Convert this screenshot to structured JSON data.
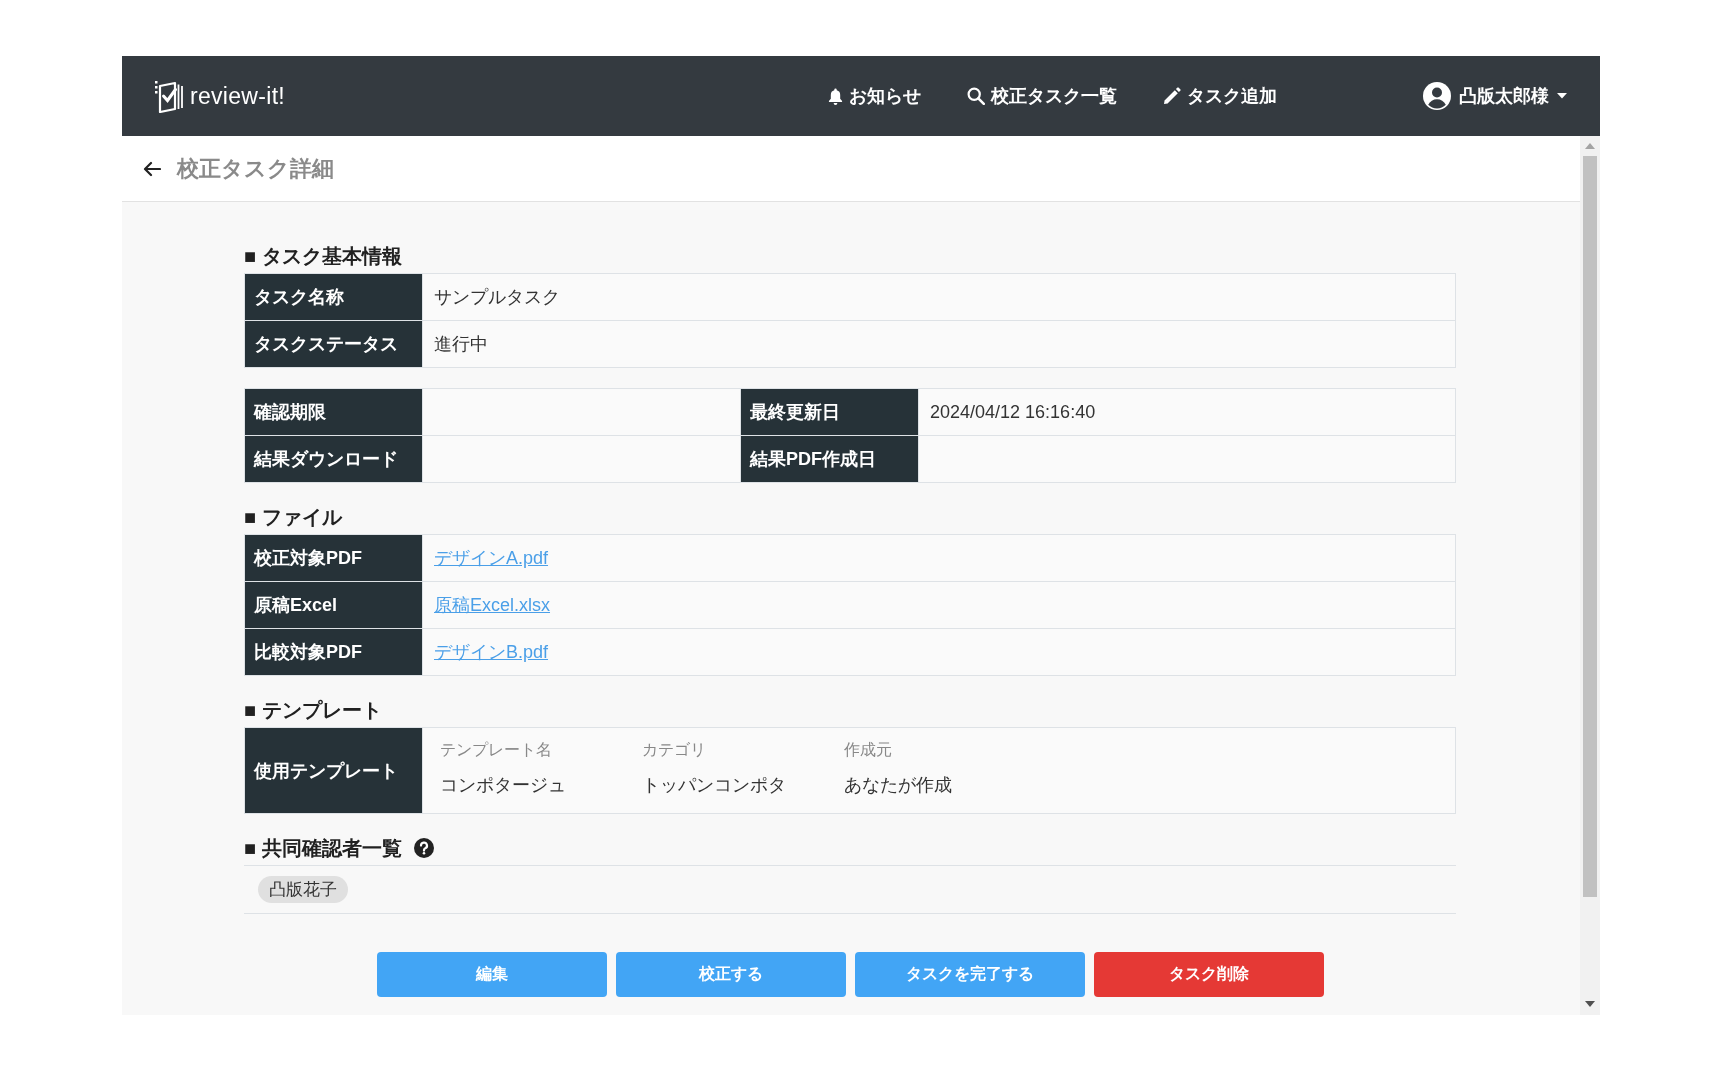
{
  "header": {
    "logo": "review-it!",
    "nav": [
      {
        "kind": "notifications",
        "label": "お知らせ"
      },
      {
        "kind": "search",
        "label": "校正タスク一覧"
      },
      {
        "kind": "add",
        "label": "タスク追加"
      }
    ],
    "user": "凸版太郎様"
  },
  "page_title": "校正タスク詳細",
  "sections": [
    {
      "kind": "info",
      "title": "■ タスク基本情報",
      "tables": [
        {
          "rows": [
            [
              {
                "label": "タスク名称",
                "value": "サンプルタスク"
              }
            ],
            [
              {
                "label": "タスクステータス",
                "value": "進行中"
              }
            ]
          ]
        },
        {
          "rows": [
            [
              {
                "label": "確認期限"
              },
              {
                "label": "最終更新日",
                "value": "2024/04/12 16:16:40"
              }
            ],
            [
              {
                "label": "結果ダウンロード"
              },
              {
                "label": "結果PDF作成日"
              }
            ]
          ]
        }
      ]
    },
    {
      "kind": "files",
      "title": "■ ファイル",
      "rows": [
        {
          "label": "校正対象PDF",
          "link": "デザインA.pdf"
        },
        {
          "label": "原稿Excel",
          "link": "原稿Excel.xlsx"
        },
        {
          "label": "比較対象PDF",
          "link": "デザインB.pdf"
        }
      ]
    },
    {
      "kind": "template",
      "title": "■ テンプレート",
      "label": "使用テンプレート",
      "fields": [
        {
          "label": "テンプレート名",
          "value": "コンポタージュ"
        },
        {
          "label": "カテゴリ",
          "value": "トッパンコンポタ"
        },
        {
          "label": "作成元",
          "value": "あなたが作成"
        }
      ]
    },
    {
      "kind": "collaborators",
      "title": "■ 共同確認者一覧",
      "help": true,
      "members": [
        "凸版花子"
      ]
    }
  ],
  "buttons": [
    {
      "kind": "primary",
      "label": "編集"
    },
    {
      "kind": "primary",
      "label": "校正する"
    },
    {
      "kind": "primary",
      "label": "タスクを完了する"
    },
    {
      "kind": "danger",
      "label": "タスク削除"
    }
  ]
}
